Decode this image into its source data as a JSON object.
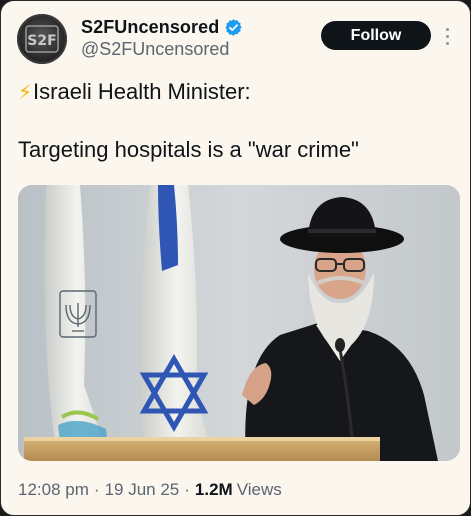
{
  "author": {
    "display_name": "S2FUncensored",
    "handle": "@S2FUncensored",
    "verified": true,
    "avatar_text": "S2F"
  },
  "actions": {
    "follow_label": "Follow",
    "more_icon": "more-vertical-icon"
  },
  "tweet": {
    "emoji": "⚡",
    "line1": "Israeli Health Minister:",
    "line2": "Targeting hospitals is a \"war crime\""
  },
  "media": {
    "description_icon": "photo"
  },
  "meta": {
    "time": "12:08 pm",
    "date": "19 Jun 25",
    "views_count": "1.2M",
    "views_label": "Views",
    "separator": "·"
  },
  "colors": {
    "card_bg": "#fbf6ee",
    "text_primary": "#0f1419",
    "text_secondary": "#5b6670",
    "verified_blue": "#1d9bf0",
    "follow_bg": "#0f1419"
  }
}
